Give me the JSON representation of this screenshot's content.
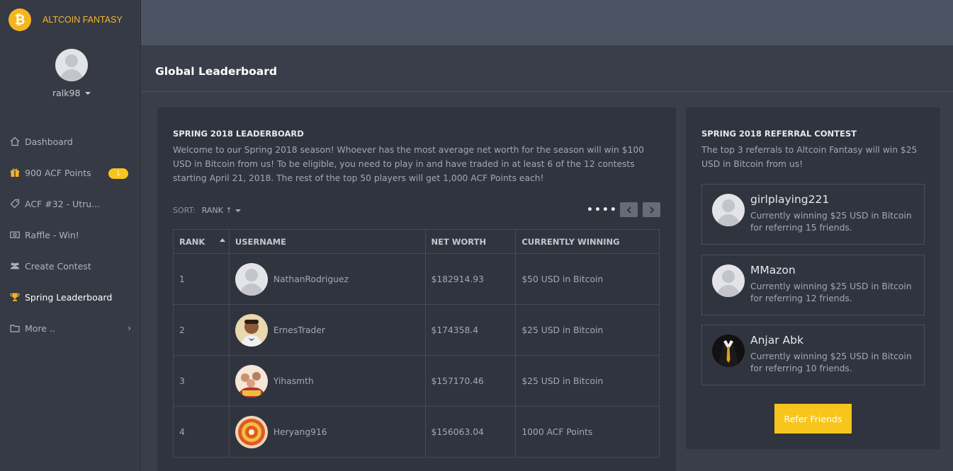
{
  "brand": {
    "name": "ALTCOIN FANTASY",
    "logo_icon": "bitcoin-icon",
    "accent_color": "#f6b51f"
  },
  "user": {
    "username": "ralk98"
  },
  "sidebar": {
    "items": [
      {
        "label": "Dashboard",
        "icon": "home-icon"
      },
      {
        "label": "900 ACF Points",
        "icon": "gift-icon",
        "badge": "1"
      },
      {
        "label": "ACF #32 - Utru...",
        "icon": "tag-icon"
      },
      {
        "label": "Raffle - Win!",
        "icon": "money-icon"
      },
      {
        "label": "Create Contest",
        "icon": "users-icon"
      },
      {
        "label": "Spring Leaderboard",
        "icon": "trophy-icon",
        "active": true
      },
      {
        "label": "More ..",
        "icon": "folder-icon"
      }
    ]
  },
  "page": {
    "title": "Global Leaderboard"
  },
  "leaderboard": {
    "title": "SPRING 2018 LEADERBOARD",
    "description": "Welcome to our Spring 2018 season! Whoever has the most average net worth for the season will win $100 USD in Bitcoin from us! To be eligible, you need to play in and have traded in at least 6 of the 12 contests starting April 21, 2018. The rest of the top 50 players will get 1,000 ACF Points each!",
    "sort_label": "SORT:",
    "sort_value": "RANK ↑",
    "pagination_dots": "••••",
    "columns": [
      "RANK",
      "USERNAME",
      "NET WORTH",
      "CURRENTLY WINNING"
    ],
    "rows": [
      {
        "rank": "1",
        "username": "NathanRodriguez",
        "net_worth": "$182914.93",
        "winning": "$50 USD in Bitcoin",
        "avatar": "default"
      },
      {
        "rank": "2",
        "username": "ErnesTrader",
        "net_worth": "$174358.4",
        "winning": "$25 USD in Bitcoin",
        "avatar": "child-photo"
      },
      {
        "rank": "3",
        "username": "Yihasmth",
        "net_worth": "$157170.46",
        "winning": "$25 USD in Bitcoin",
        "avatar": "group-photo"
      },
      {
        "rank": "4",
        "username": "Heryang916",
        "net_worth": "$156063.04",
        "winning": "1000 ACF Points",
        "avatar": "pattern-photo"
      }
    ]
  },
  "referral": {
    "title": "SPRING 2018 REFERRAL CONTEST",
    "description": "The top 3 referrals to Altcoin Fantasy will win $25 USD in Bitcoin from us!",
    "items": [
      {
        "name": "girlplaying221",
        "desc": "Currently winning $25 USD in Bitcoin for referring 15 friends.",
        "avatar": "default"
      },
      {
        "name": "MMazon",
        "desc": "Currently winning $25 USD in Bitcoin for referring 12 friends.",
        "avatar": "default"
      },
      {
        "name": "Anjar Abk",
        "desc": "Currently winning $25 USD in Bitcoin for referring 10 friends.",
        "avatar": "suit-photo"
      }
    ],
    "button_label": "Refer Friends"
  }
}
